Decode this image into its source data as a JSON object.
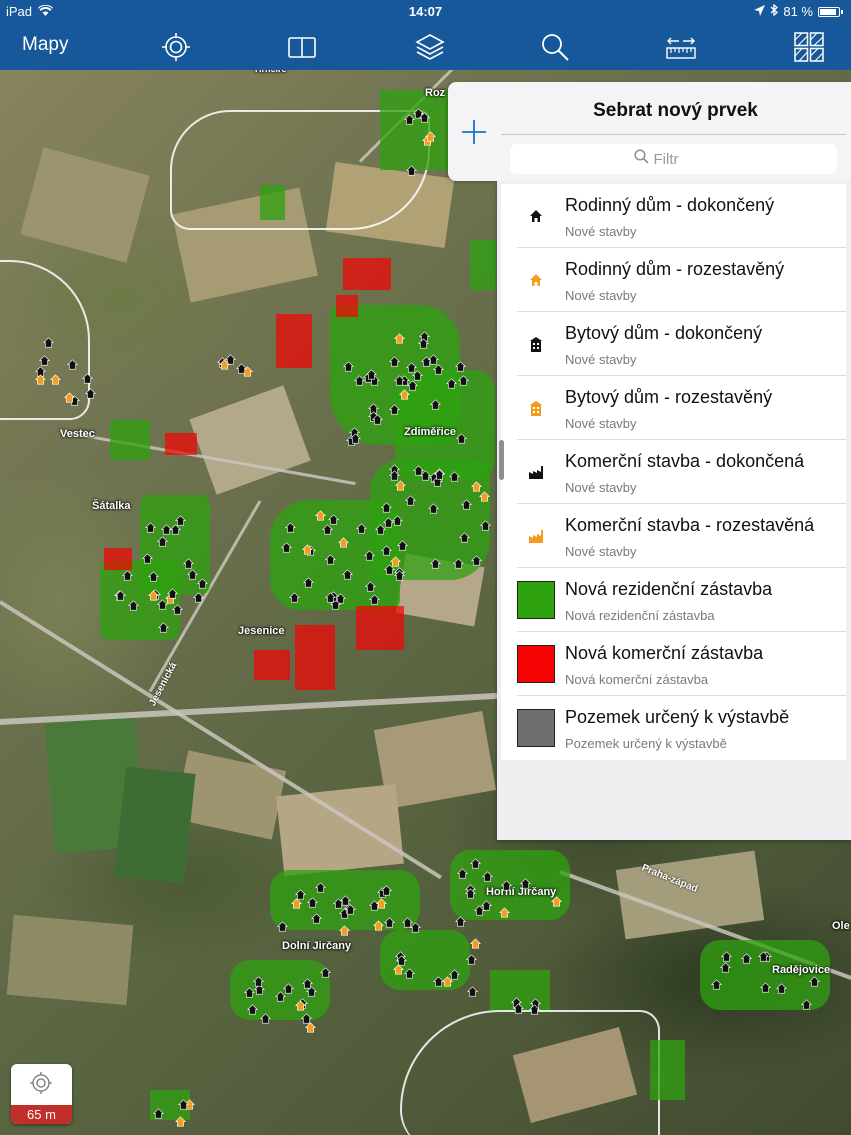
{
  "status_bar": {
    "device": "iPad",
    "time": "14:07",
    "battery": "81 %"
  },
  "toolbar": {
    "maps_label": "Mapy",
    "icons": [
      "locate-icon",
      "bookmarks-icon",
      "layers-icon",
      "search-icon",
      "measure-icon",
      "basemap-icon"
    ]
  },
  "panel": {
    "title": "Sebrat nový prvek",
    "search_placeholder": "Filtr",
    "items": [
      {
        "title": "Rodinný dům - dokončený",
        "subtitle": "Nové stavby",
        "icon": "house-icon",
        "color": "#111111"
      },
      {
        "title": "Rodinný dům - rozestavěný",
        "subtitle": "Nové stavby",
        "icon": "house-icon",
        "color": "#f39c1f"
      },
      {
        "title": "Bytový dům - dokončený",
        "subtitle": "Nové stavby",
        "icon": "apartment-icon",
        "color": "#111111"
      },
      {
        "title": "Bytový dům - rozestavěný",
        "subtitle": "Nové stavby",
        "icon": "apartment-icon",
        "color": "#f39c1f"
      },
      {
        "title": "Komerční stavba - dokončená",
        "subtitle": "Nové stavby",
        "icon": "factory-icon",
        "color": "#111111"
      },
      {
        "title": "Komerční stavba - rozestavěná",
        "subtitle": "Nové stavby",
        "icon": "factory-icon",
        "color": "#f39c1f"
      },
      {
        "title": "Nová rezidenční zástavba",
        "subtitle": "Nová rezidenční zástavba",
        "icon": "swatch",
        "color": "#2ea10f"
      },
      {
        "title": "Nová komerční zástavba",
        "subtitle": "Nová komerční zástavba",
        "icon": "swatch",
        "color": "#f40404"
      },
      {
        "title": "Pozemek určený k výstavbě",
        "subtitle": "Pozemek určený k výstavbě",
        "icon": "swatch",
        "color": "#6e6e6e"
      }
    ]
  },
  "map": {
    "places": [
      "Vestec",
      "Zdiměřice",
      "Šátalka",
      "Jesenice",
      "Horní Jirčany",
      "Dolní Jirčany",
      "Radějovice",
      "Ole",
      "Roz",
      "Hrnčíře"
    ],
    "roads": [
      "Jesenická",
      "Praha-západ"
    ],
    "colors": {
      "residential": "#2ea10f",
      "commercial": "#f40404"
    }
  },
  "scale": {
    "label": "65 m"
  }
}
